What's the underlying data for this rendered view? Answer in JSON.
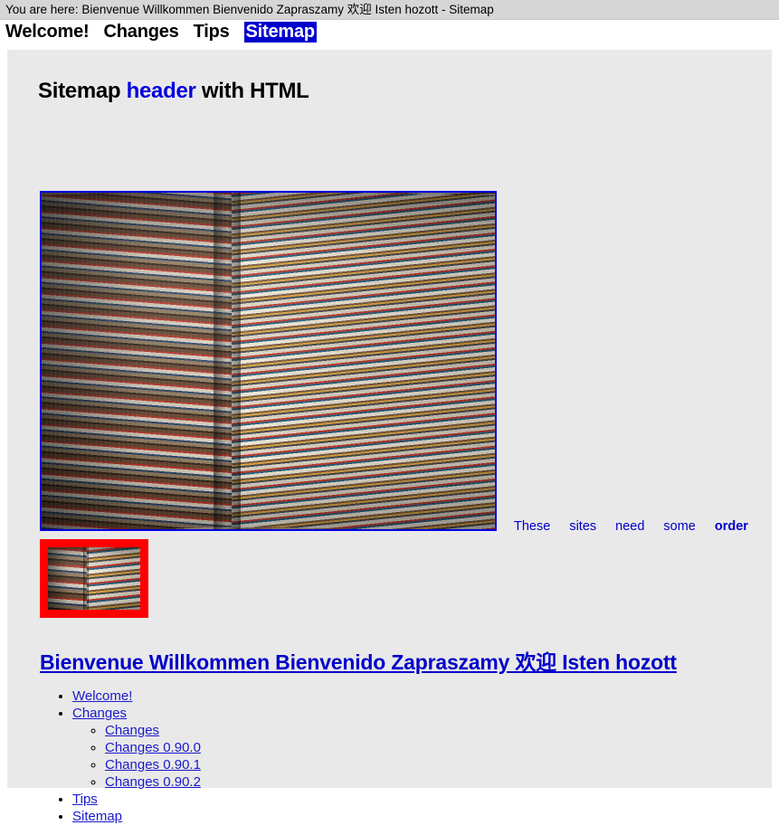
{
  "breadcrumb": {
    "text": "You are here: Bienvenue Willkommen Bienvenido Zapraszamy 欢迎 Isten hozott - Sitemap"
  },
  "nav": {
    "items": [
      {
        "label": "Welcome!",
        "selected": false
      },
      {
        "label": "Changes",
        "selected": false
      },
      {
        "label": "Tips",
        "selected": false
      },
      {
        "label": "Sitemap",
        "selected": true
      }
    ]
  },
  "main": {
    "title_part1": "Sitemap ",
    "title_highlight": "header",
    "title_part2": " with HTML",
    "photo_alt": "stack-of-books-photo",
    "thumb_alt": "stack-of-books-thumbnail",
    "order_links": [
      {
        "label": "These",
        "bold": false
      },
      {
        "label": "sites",
        "bold": false
      },
      {
        "label": "need",
        "bold": false
      },
      {
        "label": "some",
        "bold": false
      },
      {
        "label": "order",
        "bold": true
      }
    ],
    "section_heading": "Bienvenue Willkommen Bienvenido Zapraszamy 欢迎 Isten hozott",
    "tree": [
      {
        "label": "Welcome!"
      },
      {
        "label": "Changes",
        "children": [
          {
            "label": "Changes"
          },
          {
            "label": "Changes 0.90.0"
          },
          {
            "label": "Changes 0.90.1"
          },
          {
            "label": "Changes 0.90.2"
          }
        ]
      },
      {
        "label": "Tips"
      },
      {
        "label": "Sitemap"
      }
    ]
  },
  "colors": {
    "link": "#0000cc",
    "selected_bg": "#0000cc",
    "selected_fg": "#ffffff",
    "photo_border": "#0000e0",
    "thumb_border": "#ff0000",
    "content_bg": "#e9e9e9",
    "breadcrumb_bg": "#d6d6d6"
  }
}
